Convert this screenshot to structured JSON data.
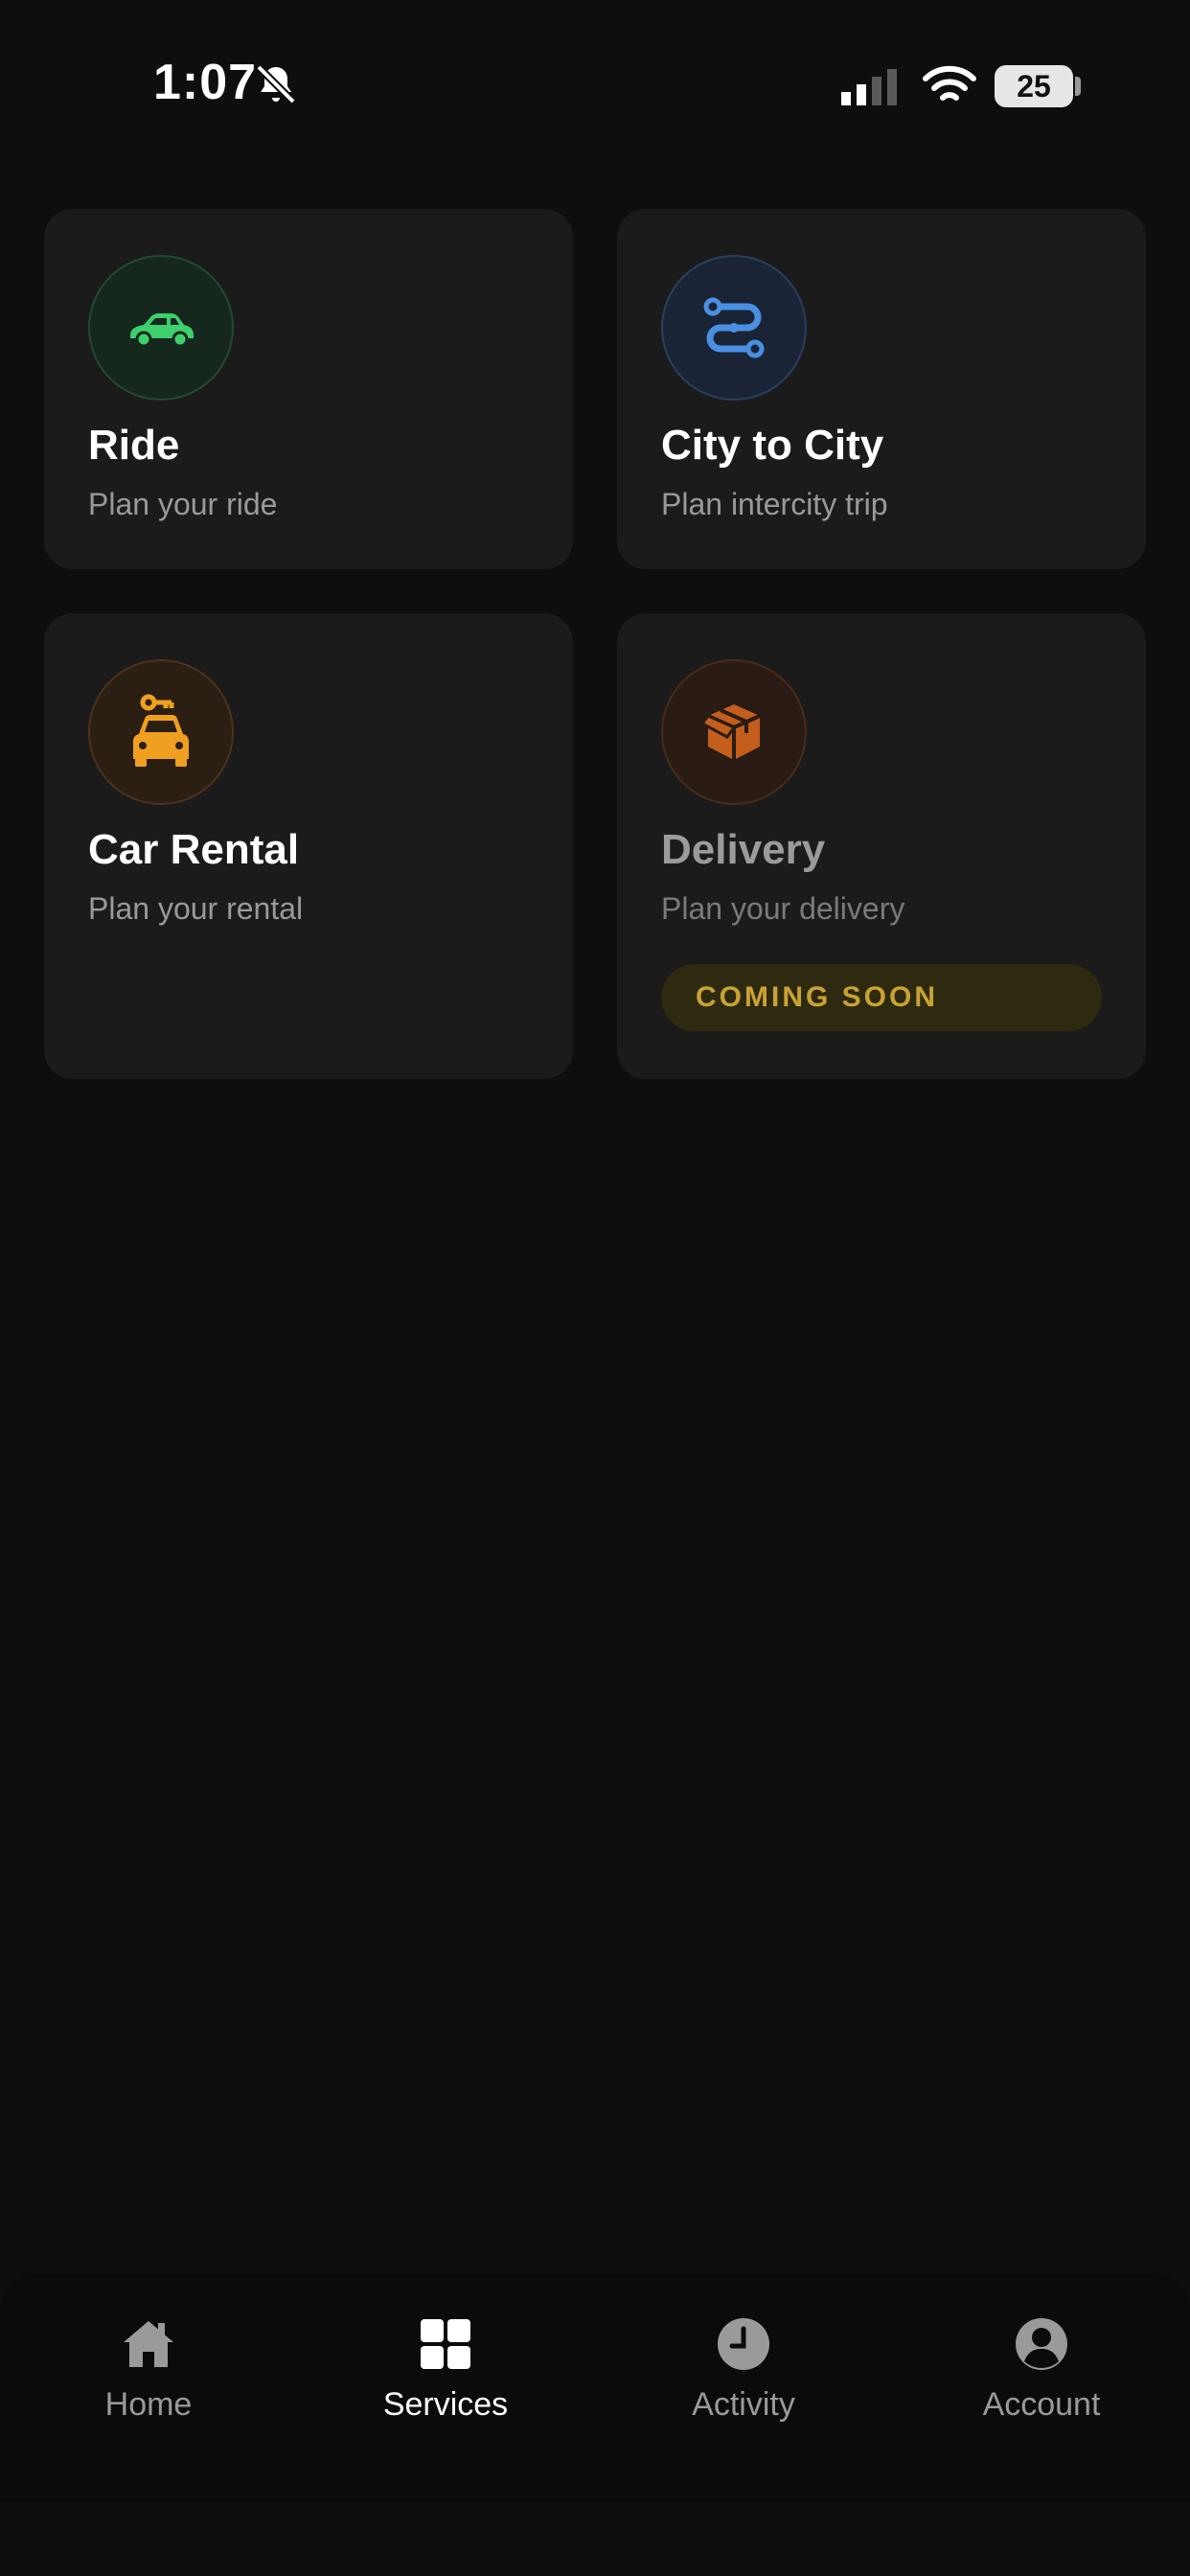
{
  "status_bar": {
    "time": "1:07",
    "battery": "25",
    "icons": [
      "bell-muted-icon",
      "signal-icon",
      "wifi-icon",
      "battery-icon"
    ]
  },
  "services": [
    {
      "title": "Ride",
      "subtitle": "Plan your ride",
      "icon": "car-icon",
      "accent": "#3ecf6e"
    },
    {
      "title": "City to City",
      "subtitle": "Plan intercity trip",
      "icon": "route-icon",
      "accent": "#4a90e2"
    },
    {
      "title": "Car Rental",
      "subtitle": "Plan your rental",
      "icon": "car-key-icon",
      "accent": "#f0a020"
    },
    {
      "title": "Delivery",
      "subtitle": "Plan your delivery",
      "icon": "package-icon",
      "accent": "#e06a1e",
      "badge": "COMING SOON"
    }
  ],
  "nav": {
    "items": [
      {
        "label": "Home",
        "icon": "home-icon"
      },
      {
        "label": "Services",
        "icon": "grid-icon",
        "active": true
      },
      {
        "label": "Activity",
        "icon": "clock-icon"
      },
      {
        "label": "Account",
        "icon": "user-icon"
      }
    ]
  },
  "colors": {
    "background": "#0e0e0e",
    "card": "#1b1b1b",
    "badge_text": "#c9a233"
  }
}
